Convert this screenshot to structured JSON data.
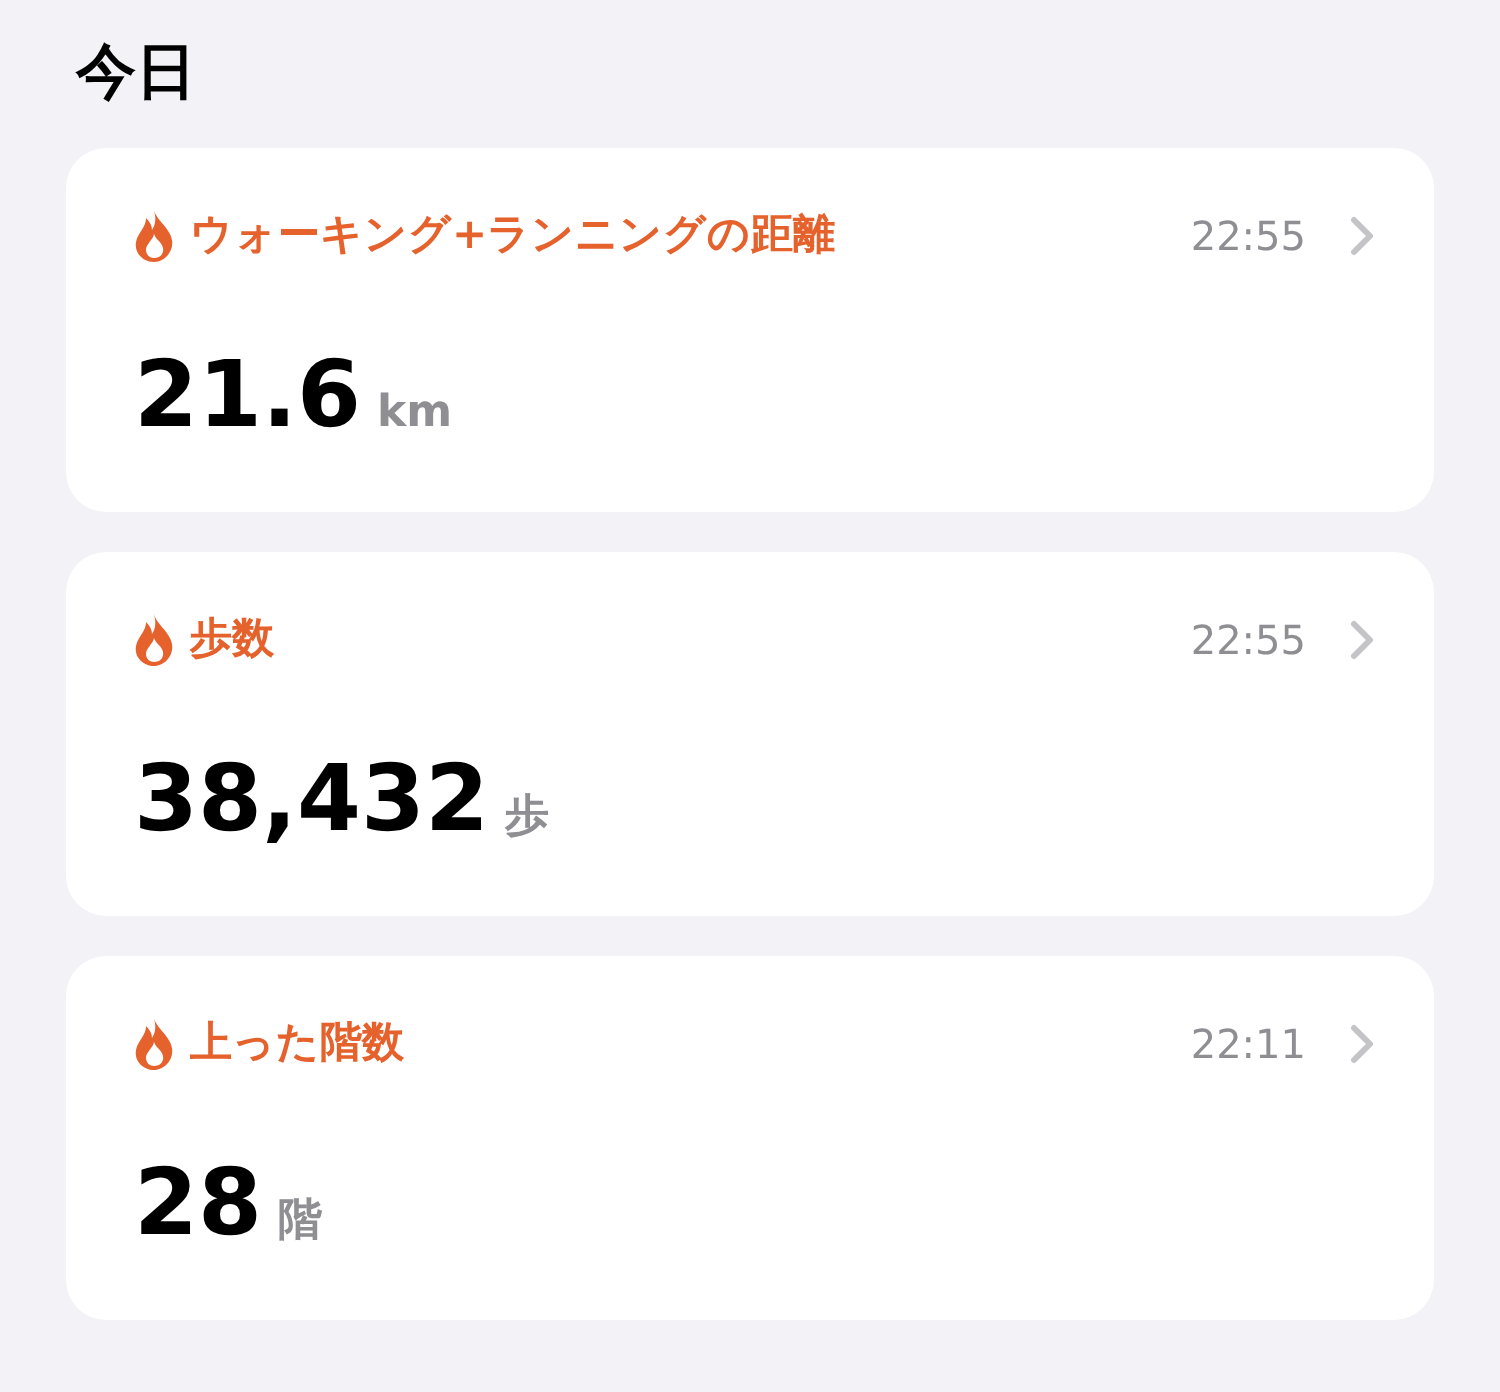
{
  "section_title": "今日",
  "cards": [
    {
      "title": "ウォーキング+ランニングの距離",
      "time": "22:55",
      "value": "21.6",
      "unit": "km"
    },
    {
      "title": "歩数",
      "time": "22:55",
      "value": "38,432",
      "unit": "歩"
    },
    {
      "title": "上った階数",
      "time": "22:11",
      "value": "28",
      "unit": "階"
    }
  ]
}
